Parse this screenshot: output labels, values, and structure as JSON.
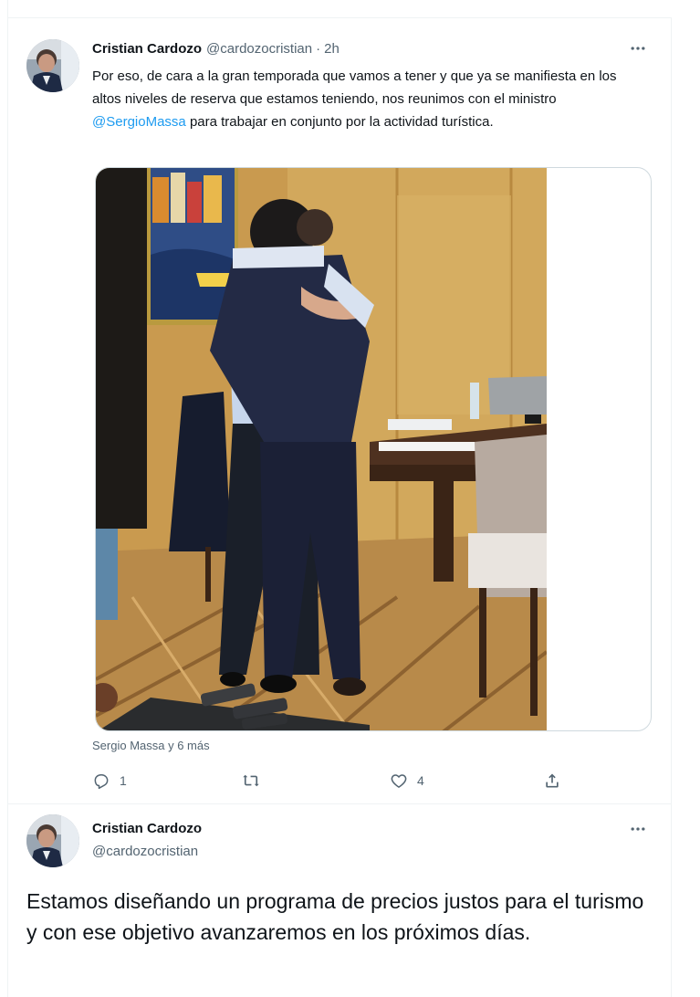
{
  "tweet1": {
    "display_name": "Cristian Cardozo",
    "handle": "@cardozocristian",
    "separator": "·",
    "time": "2h",
    "more_icon": "more-horizontal-icon",
    "text_before": "Por eso, de cara a la gran temporada que vamos a tener y que ya se manifiesta en los altos niveles de reserva que estamos teniendo, nos reunimos con el ministro ",
    "mention": "@SergioMassa",
    "text_after": " para trabajar en conjunto por la actividad turística.",
    "tagged_people": "Sergio Massa y 6 más",
    "actions": {
      "reply_count": "1",
      "retweet_count": "",
      "like_count": "4",
      "reply_icon": "reply-icon",
      "retweet_icon": "retweet-icon",
      "like_icon": "heart-icon",
      "share_icon": "share-icon"
    }
  },
  "tweet2": {
    "display_name": "Cristian Cardozo",
    "handle": "@cardozocristian",
    "text": "Estamos diseñando un programa de precios justos para el turismo y con ese objetivo avanzaremos en los próximos días."
  },
  "colors": {
    "text": "#0f1419",
    "secondary": "#536471",
    "link": "#1d9bf0",
    "border": "#cfd9de"
  }
}
